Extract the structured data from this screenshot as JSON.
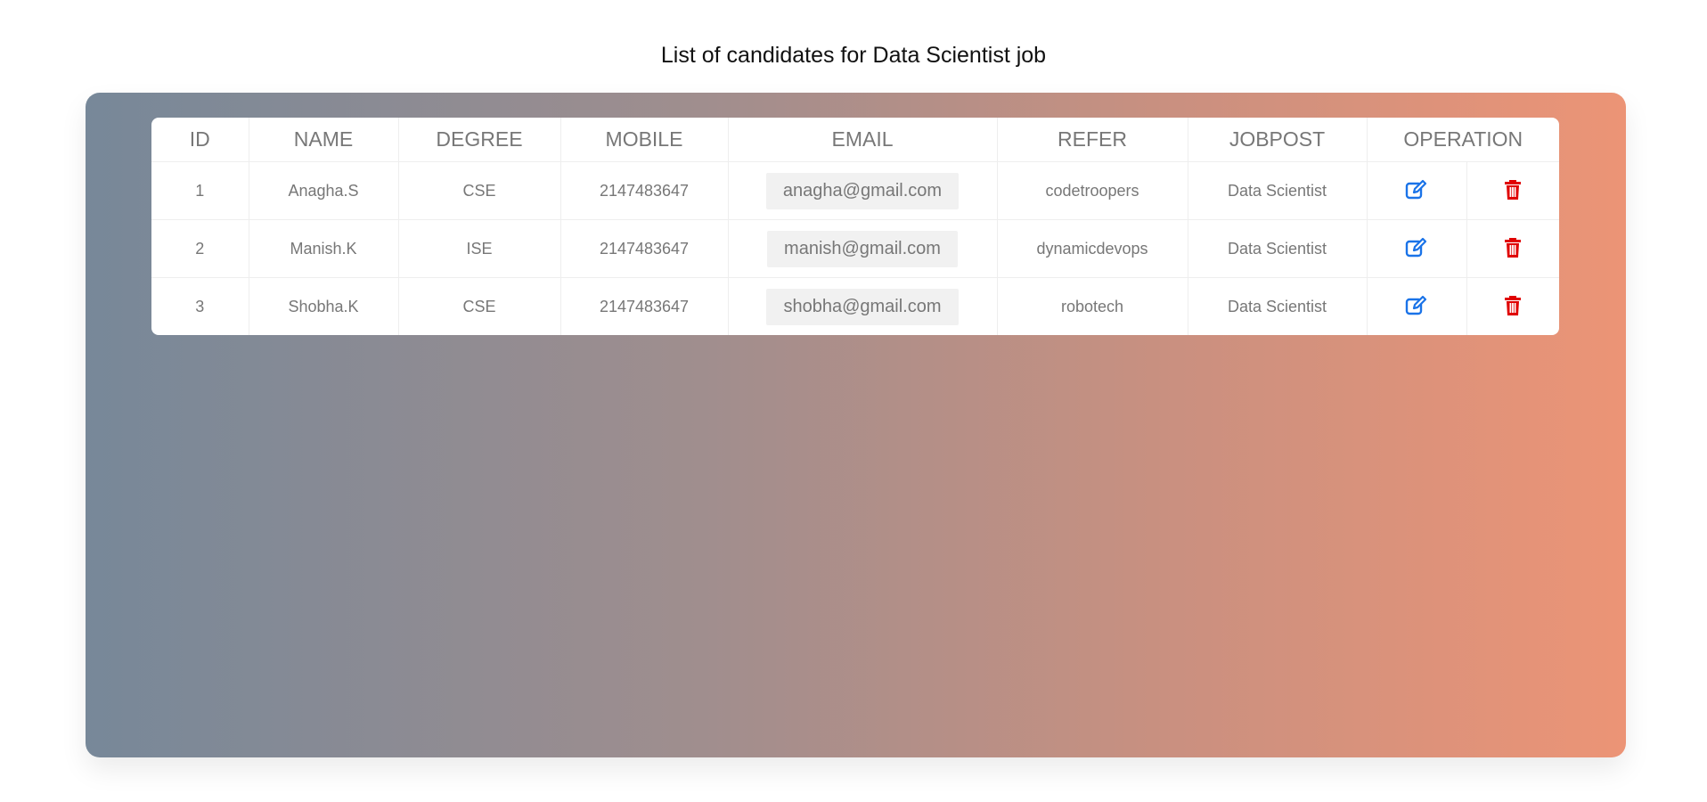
{
  "page": {
    "title": "List of candidates for Data Scientist job"
  },
  "table": {
    "headers": {
      "id": "ID",
      "name": "NAME",
      "degree": "DEGREE",
      "mobile": "MOBILE",
      "email": "EMAIL",
      "refer": "REFER",
      "jobpost": "JOBPOST",
      "operation": "OPERATION"
    },
    "rows": [
      {
        "id": "1",
        "name": "Anagha.S",
        "degree": "CSE",
        "mobile": "2147483647",
        "email": "anagha@gmail.com",
        "refer": "codetroopers",
        "jobpost": "Data Scientist"
      },
      {
        "id": "2",
        "name": "Manish.K",
        "degree": "ISE",
        "mobile": "2147483647",
        "email": "manish@gmail.com",
        "refer": "dynamicdevops",
        "jobpost": "Data Scientist"
      },
      {
        "id": "3",
        "name": "Shobha.K",
        "degree": "CSE",
        "mobile": "2147483647",
        "email": "shobha@gmail.com",
        "refer": "robotech",
        "jobpost": "Data Scientist"
      }
    ],
    "operations": {
      "edit_icon": "edit-icon",
      "delete_icon": "trash-icon"
    }
  },
  "colors": {
    "gradient_start": "#778899",
    "gradient_end": "#ec9476",
    "edit_icon": "#1a73e8",
    "delete_icon": "#e00000",
    "cell_text": "#777777"
  }
}
